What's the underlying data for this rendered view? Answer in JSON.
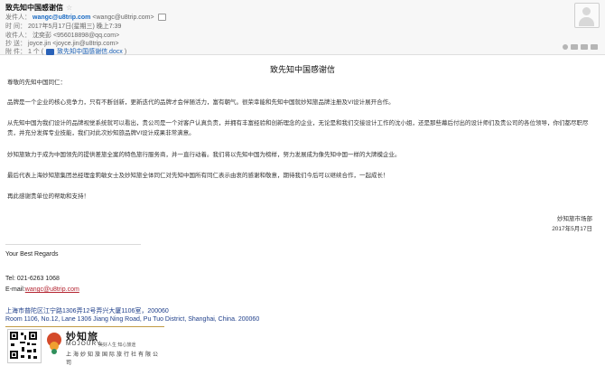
{
  "email": {
    "subject": "致先知中国感谢信",
    "from_label": "发件人：",
    "from_name": "wangc@u8trip.com",
    "from_addr": "<wangc@u8trip.com>",
    "time_label": "时 间：",
    "time_value": "2017年5月17日(星期三) 晚上7:39",
    "to_label": "收件人：",
    "to_value": "沈奕彭 <956018898@qq.com>",
    "cc_label": "抄 送：",
    "cc_value": "joyce.jin <joyce.jin@u8trip.com>",
    "att_label": "附 件：",
    "att_count": "1 个 (",
    "att_name": "致先知中国感谢信.docx",
    "att_close": ")"
  },
  "letter": {
    "title": "致先知中国感谢信",
    "greeting": "尊敬的先知中国同仁：",
    "p1": "品牌是一个企业的核心竞争力，只有不断创新，更新迭代的品牌才会伴随活力，富有朝气。很荣幸能和先知中国就妙知旅品牌注册及VI设计展开合作。",
    "p2": "从先知中国为我们设计的品牌视觉系统就可以看出，贵公司是一个对客户认真负责，并拥有丰富经验和创新理念的企业，无论是和我们交接设计工作的沈小姐，还是那些幕后付出的设计师们及贵公司的各位领导，你们都尽职尽责，并充分发挥专业技能，我们对此次妙知旅品牌VI设计成果非常满意。",
    "p3": "妙知旅致力于成为中国领先的提供差旅全案的特色旅行服务商，并一直行动着。我们将以先知中国为榜样，努力发展成为像先知中国一样的大牌模企业。",
    "p4": "最后代表上海妙知旅集团总经理金莉敏女士及妙知旅全体同仁对先知中国所有同仁表示由衷的感谢和敬意，期待我们今后可以继续合作，一起成长！",
    "p5": "再此感谢贵单位的帮助和支持！",
    "sign_dept": "妙知旅市场部",
    "sign_date": "2017年5月17日"
  },
  "signature": {
    "regards": "Your Best Regards",
    "tel": "Tel: 021-6263 1068",
    "email_label": "E-mail:",
    "email_link": "wangc@u8trip.com",
    "addr_cn": "上海市普陀区江宁路1306弄12号弄兴大厦1106室，200060",
    "addr_en": "Room 1106, No.12, Lane 1306 Jiang Ning Road, Pu Tuo District, Shanghai, China. 200060"
  },
  "logo": {
    "brand_cn": "妙知旅",
    "brand_en": "MOJOURY",
    "slogan": "美好人生 知心旅途",
    "company": "上海妙知旅国际旅行社有限公司"
  },
  "colors": {
    "sender": "#1a6bc4",
    "link": "#b3222f",
    "address": "#1f3f8a",
    "divider": "#c29b44"
  }
}
